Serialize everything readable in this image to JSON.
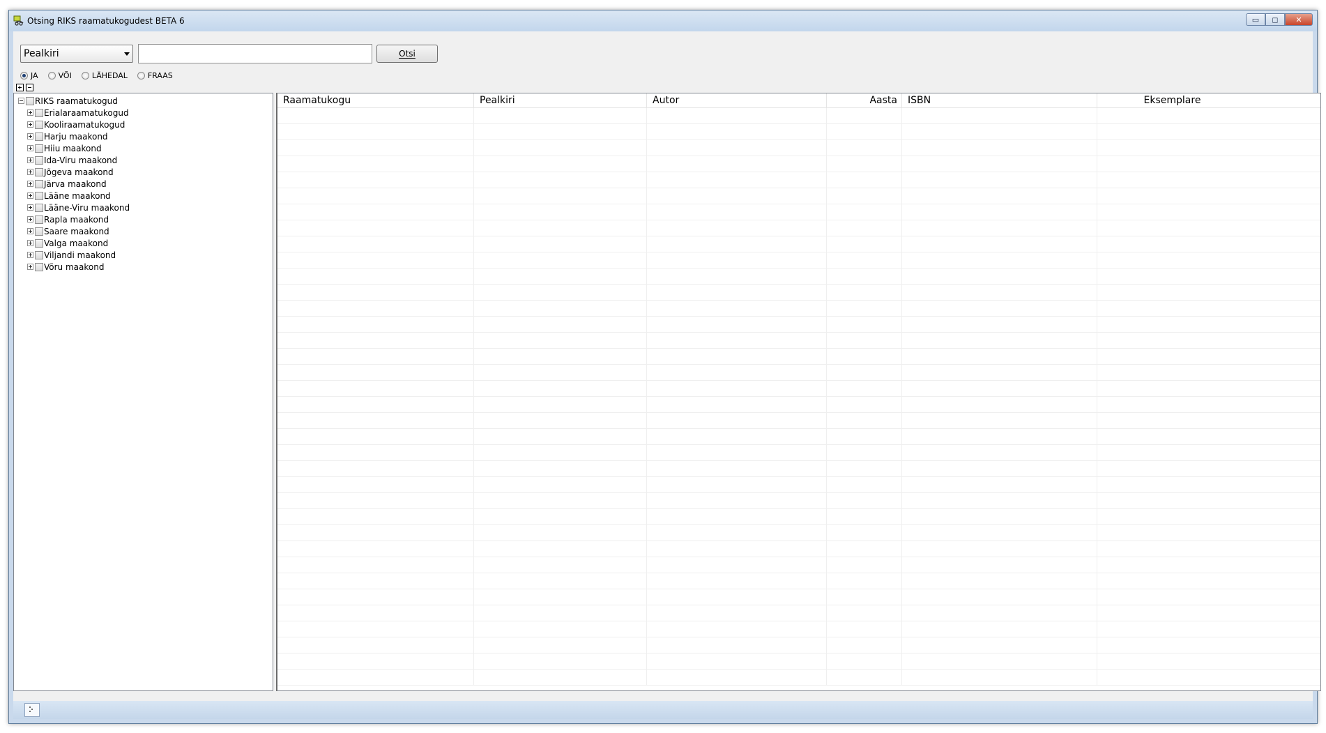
{
  "window": {
    "title": "Otsing RIKS raamatukogudest BETA 6",
    "controls": {
      "minimize": "▭",
      "maximize": "◻",
      "close": "✕"
    }
  },
  "search": {
    "field_selected": "Pealkiri",
    "query_value": "",
    "button_label": "Otsi"
  },
  "modes": [
    {
      "label": "JA",
      "checked": true
    },
    {
      "label": "VÕI",
      "checked": false
    },
    {
      "label": "LÄHEDAL",
      "checked": false
    },
    {
      "label": "FRAAS",
      "checked": false
    }
  ],
  "tree": {
    "root": "RIKS raamatukogud",
    "children": [
      "Erialaraamatukogud",
      "Kooliraamatukogud",
      "Harju maakond",
      "Hiiu maakond",
      "Ida-Viru maakond",
      "Jõgeva maakond",
      "Järva maakond",
      "Lääne maakond",
      "Lääne-Viru maakond",
      "Rapla maakond",
      "Saare maakond",
      "Valga maakond",
      "Viljandi maakond",
      "Võru maakond"
    ]
  },
  "grid": {
    "columns": [
      "Raamatukogu",
      "Pealkiri",
      "Autor",
      "Aasta",
      "ISBN",
      "Eksemplare"
    ]
  },
  "colors": {
    "titlebar": "#c2d6ec",
    "close_button": "#c9452a",
    "window_border": "#5f7d9c"
  }
}
